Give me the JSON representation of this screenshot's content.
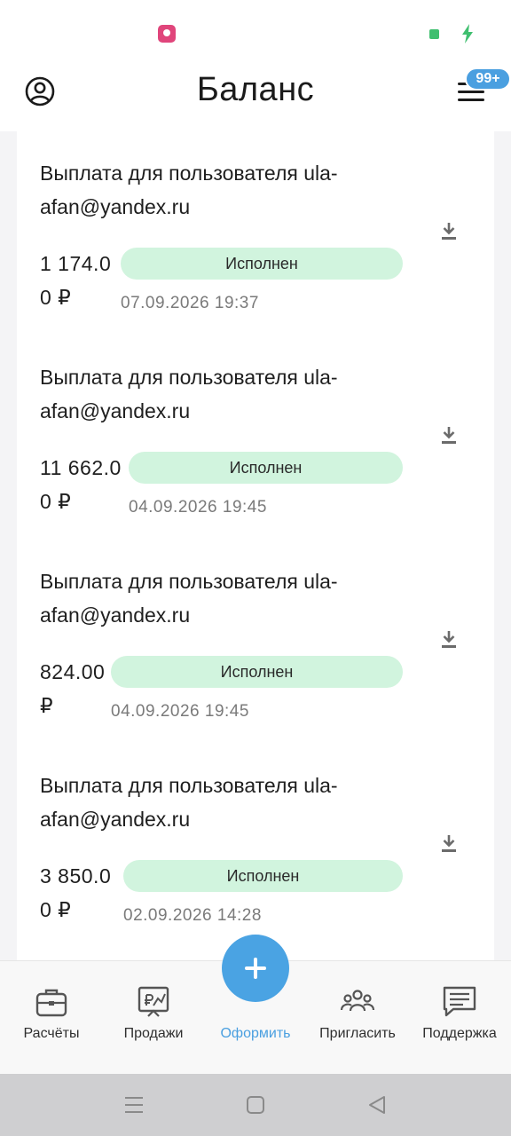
{
  "status_bar": {
    "app_icon": "photo-app-icon",
    "indicator": "green-dot-icon",
    "battery": "charging-bolt-icon",
    "accent_color": "#3fbf6f"
  },
  "header": {
    "title": "Баланс",
    "profile_icon": "profile-icon",
    "menu_icon": "hamburger-menu-icon",
    "notification_badge": "99+",
    "badge_color": "#4a9fe0"
  },
  "payouts": [
    {
      "title": "Выплата для пользователя ula-afan@yandex.ru",
      "amount": "1 174.0\n0 ₽",
      "status": "Исполнен",
      "date": "07.09.2026 19:37"
    },
    {
      "title": "Выплата для пользователя ula-afan@yandex.ru",
      "amount": "11 662.0\n0 ₽",
      "status": "Исполнен",
      "date": "04.09.2026 19:45"
    },
    {
      "title": "Выплата для пользователя ula-afan@yandex.ru",
      "amount": "824.00\n₽",
      "status": "Исполнен",
      "date": "04.09.2026 19:45"
    },
    {
      "title": "Выплата для пользователя ula-afan@yandex.ru",
      "amount": "3 850.0\n0 ₽",
      "status": "Исполнен",
      "date": "02.09.2026 14:28"
    }
  ],
  "status_badge_color": "#d1f4de",
  "bottom_nav": {
    "items": [
      {
        "label": "Расчёты",
        "icon": "briefcase-icon"
      },
      {
        "label": "Продажи",
        "icon": "sales-board-icon"
      },
      {
        "label": "Оформить",
        "icon": "plus-icon",
        "active": true
      },
      {
        "label": "Пригласить",
        "icon": "people-icon"
      },
      {
        "label": "Поддержка",
        "icon": "chat-icon"
      }
    ],
    "active_color": "#4a9fe0"
  },
  "system_nav": {
    "items": [
      "menu-icon",
      "home-icon",
      "back-icon"
    ]
  }
}
